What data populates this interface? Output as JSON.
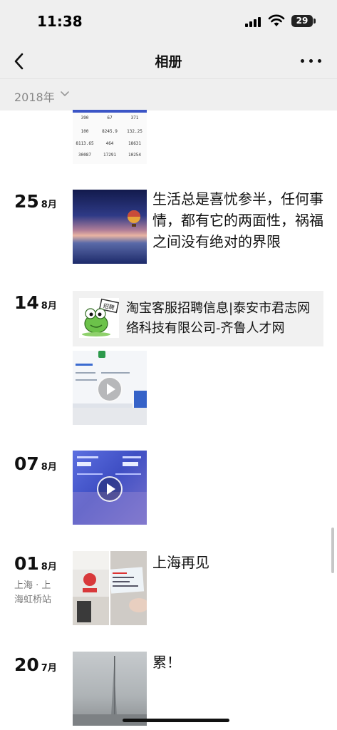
{
  "status_bar": {
    "time": "11:38",
    "battery": "29"
  },
  "nav": {
    "title": "相册",
    "back_icon": "chevron-left-icon",
    "more_icon": "ellipsis-icon"
  },
  "year_filter": {
    "label": "2018年"
  },
  "stats_thumbnail": {
    "rows": [
      [
        "390",
        "67",
        "371"
      ],
      [
        "100",
        "8245.9",
        "132.25"
      ],
      [
        "8113.65",
        "464",
        "18631"
      ],
      [
        "30087",
        "17291",
        "10254"
      ]
    ]
  },
  "posts": [
    {
      "day": "25",
      "month": "8月",
      "text": "生活总是喜忧参半，任何事情，都有它的两面性，祸福之间没有绝对的界限"
    },
    {
      "day": "14",
      "month": "8月",
      "share_title": "淘宝客服招聘信息|泰安市君志网络科技有限公司-齐鲁人才网",
      "share_badge": "招聘"
    },
    {
      "day": "07",
      "month": "8月"
    },
    {
      "day": "01",
      "month": "8月",
      "location": "上海 · 上海虹桥站",
      "text": "上海再见"
    },
    {
      "day": "20",
      "month": "7月",
      "text": "累！"
    }
  ],
  "colors": {
    "header_bg": "#efefef",
    "share_bg": "#f1f1f1",
    "text": "#111111",
    "muted": "#888888"
  }
}
